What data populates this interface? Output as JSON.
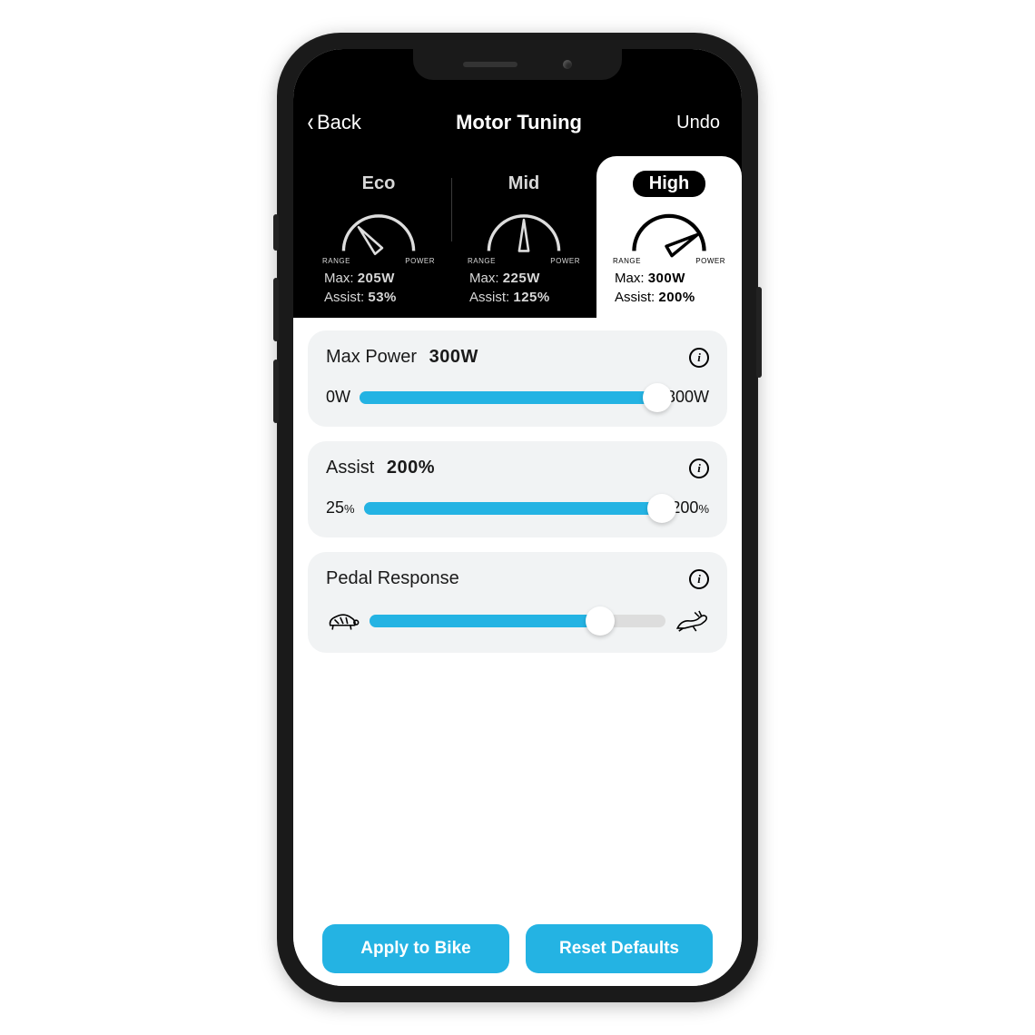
{
  "colors": {
    "accent": "#24b3e3"
  },
  "nav": {
    "back_label": "Back",
    "title": "Motor Tuning",
    "undo_label": "Undo"
  },
  "modes": {
    "range_label": "RANGE",
    "power_label": "POWER",
    "items": [
      {
        "name": "Eco",
        "max_label": "Max:",
        "max_value": "205W",
        "assist_label": "Assist:",
        "assist_value": "53%",
        "needle_angle": -130,
        "active": false
      },
      {
        "name": "Mid",
        "max_label": "Max:",
        "max_value": "225W",
        "assist_label": "Assist:",
        "assist_value": "125%",
        "needle_angle": -90,
        "active": false
      },
      {
        "name": "High",
        "max_label": "Max:",
        "max_value": "300W",
        "assist_label": "Assist:",
        "assist_value": "200%",
        "needle_angle": -30,
        "active": true
      }
    ]
  },
  "sliders": {
    "max_power": {
      "title": "Max Power",
      "value_display": "300W",
      "min_label": "0W",
      "max_label": "300W",
      "percent": 100
    },
    "assist": {
      "title": "Assist",
      "value_display": "200%",
      "min_label": "25",
      "min_suffix": "%",
      "max_label": "200",
      "max_suffix": "%",
      "percent": 100
    },
    "pedal": {
      "title": "Pedal Response",
      "percent": 78
    }
  },
  "footer": {
    "apply_label": "Apply to Bike",
    "reset_label": "Reset Defaults"
  }
}
